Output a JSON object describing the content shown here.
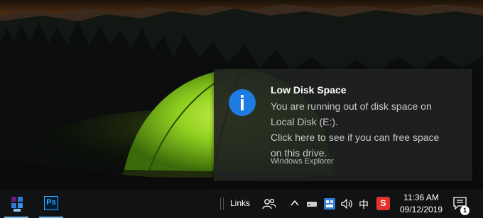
{
  "notification": {
    "title": "Low Disk Space",
    "body_lines": [
      "You are running out of disk space on",
      "Local Disk (E:).",
      "Click here to see if you can free space",
      "on this drive."
    ],
    "source": "Windows Explorer",
    "icon": "info-icon",
    "accent_color": "#1e7be2"
  },
  "taskbar": {
    "apps": [
      {
        "name": "Visual Studio",
        "icon": "visual-studio-icon"
      },
      {
        "name": "Adobe Photoshop",
        "icon": "photoshop-icon",
        "label": "Ps"
      }
    ],
    "toolbar_label": "Links",
    "tray": {
      "people_icon": "people-icon",
      "overflow_icon": "chevron-up-icon",
      "drive_icon": "drive-icon",
      "app_icon": "app-tray-icon",
      "volume_icon": "volume-icon",
      "input_method": "中",
      "sogou_label": "S"
    },
    "clock": {
      "time": "11:36 AM",
      "date": "09/12/2019"
    },
    "action_center": {
      "icon": "action-center-icon",
      "badge": "1"
    }
  }
}
